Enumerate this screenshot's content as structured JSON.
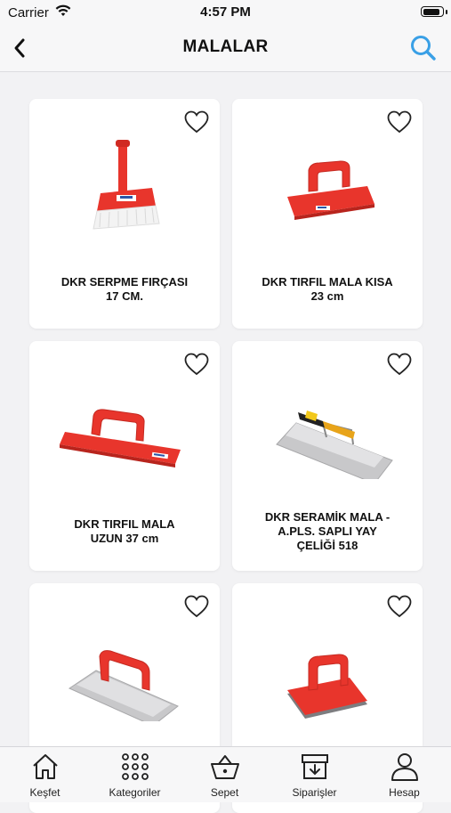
{
  "status_bar": {
    "carrier": "Carrier",
    "time": "4:57 PM",
    "battery_level": 0.9
  },
  "header": {
    "title": "MALALAR",
    "back_icon": "chevron-left-icon",
    "search_icon": "search-icon"
  },
  "colors": {
    "accent_search": "#3aa0e6",
    "product_red": "#e8352c"
  },
  "products": [
    {
      "line1": "DKR SERPME FIRÇASI",
      "line2": "17 CM.",
      "line3": "",
      "icon": "brush-icon"
    },
    {
      "line1": "DKR TIRFIL MALA KISA",
      "line2": "23 cm",
      "line3": "",
      "icon": "float-short-icon"
    },
    {
      "line1": "DKR TIRFIL MALA",
      "line2": "UZUN 37 cm",
      "line3": "",
      "icon": "float-long-icon"
    },
    {
      "line1": "DKR SERAMİK MALA -",
      "line2": "A.PLS. SAPLI YAY",
      "line3": "ÇELİĞİ 518",
      "icon": "notched-trowel-icon"
    },
    {
      "line1": "",
      "line2": "",
      "line3": "",
      "icon": "notched-trowel-red-icon"
    },
    {
      "line1": "",
      "line2": "",
      "line3": "",
      "icon": "float-grey-icon"
    }
  ],
  "tabs": [
    {
      "label": "Keşfet",
      "icon": "home-icon"
    },
    {
      "label": "Kategoriler",
      "icon": "grid-icon"
    },
    {
      "label": "Sepet",
      "icon": "basket-icon"
    },
    {
      "label": "Siparişler",
      "icon": "orders-icon"
    },
    {
      "label": "Hesap",
      "icon": "user-icon"
    }
  ]
}
